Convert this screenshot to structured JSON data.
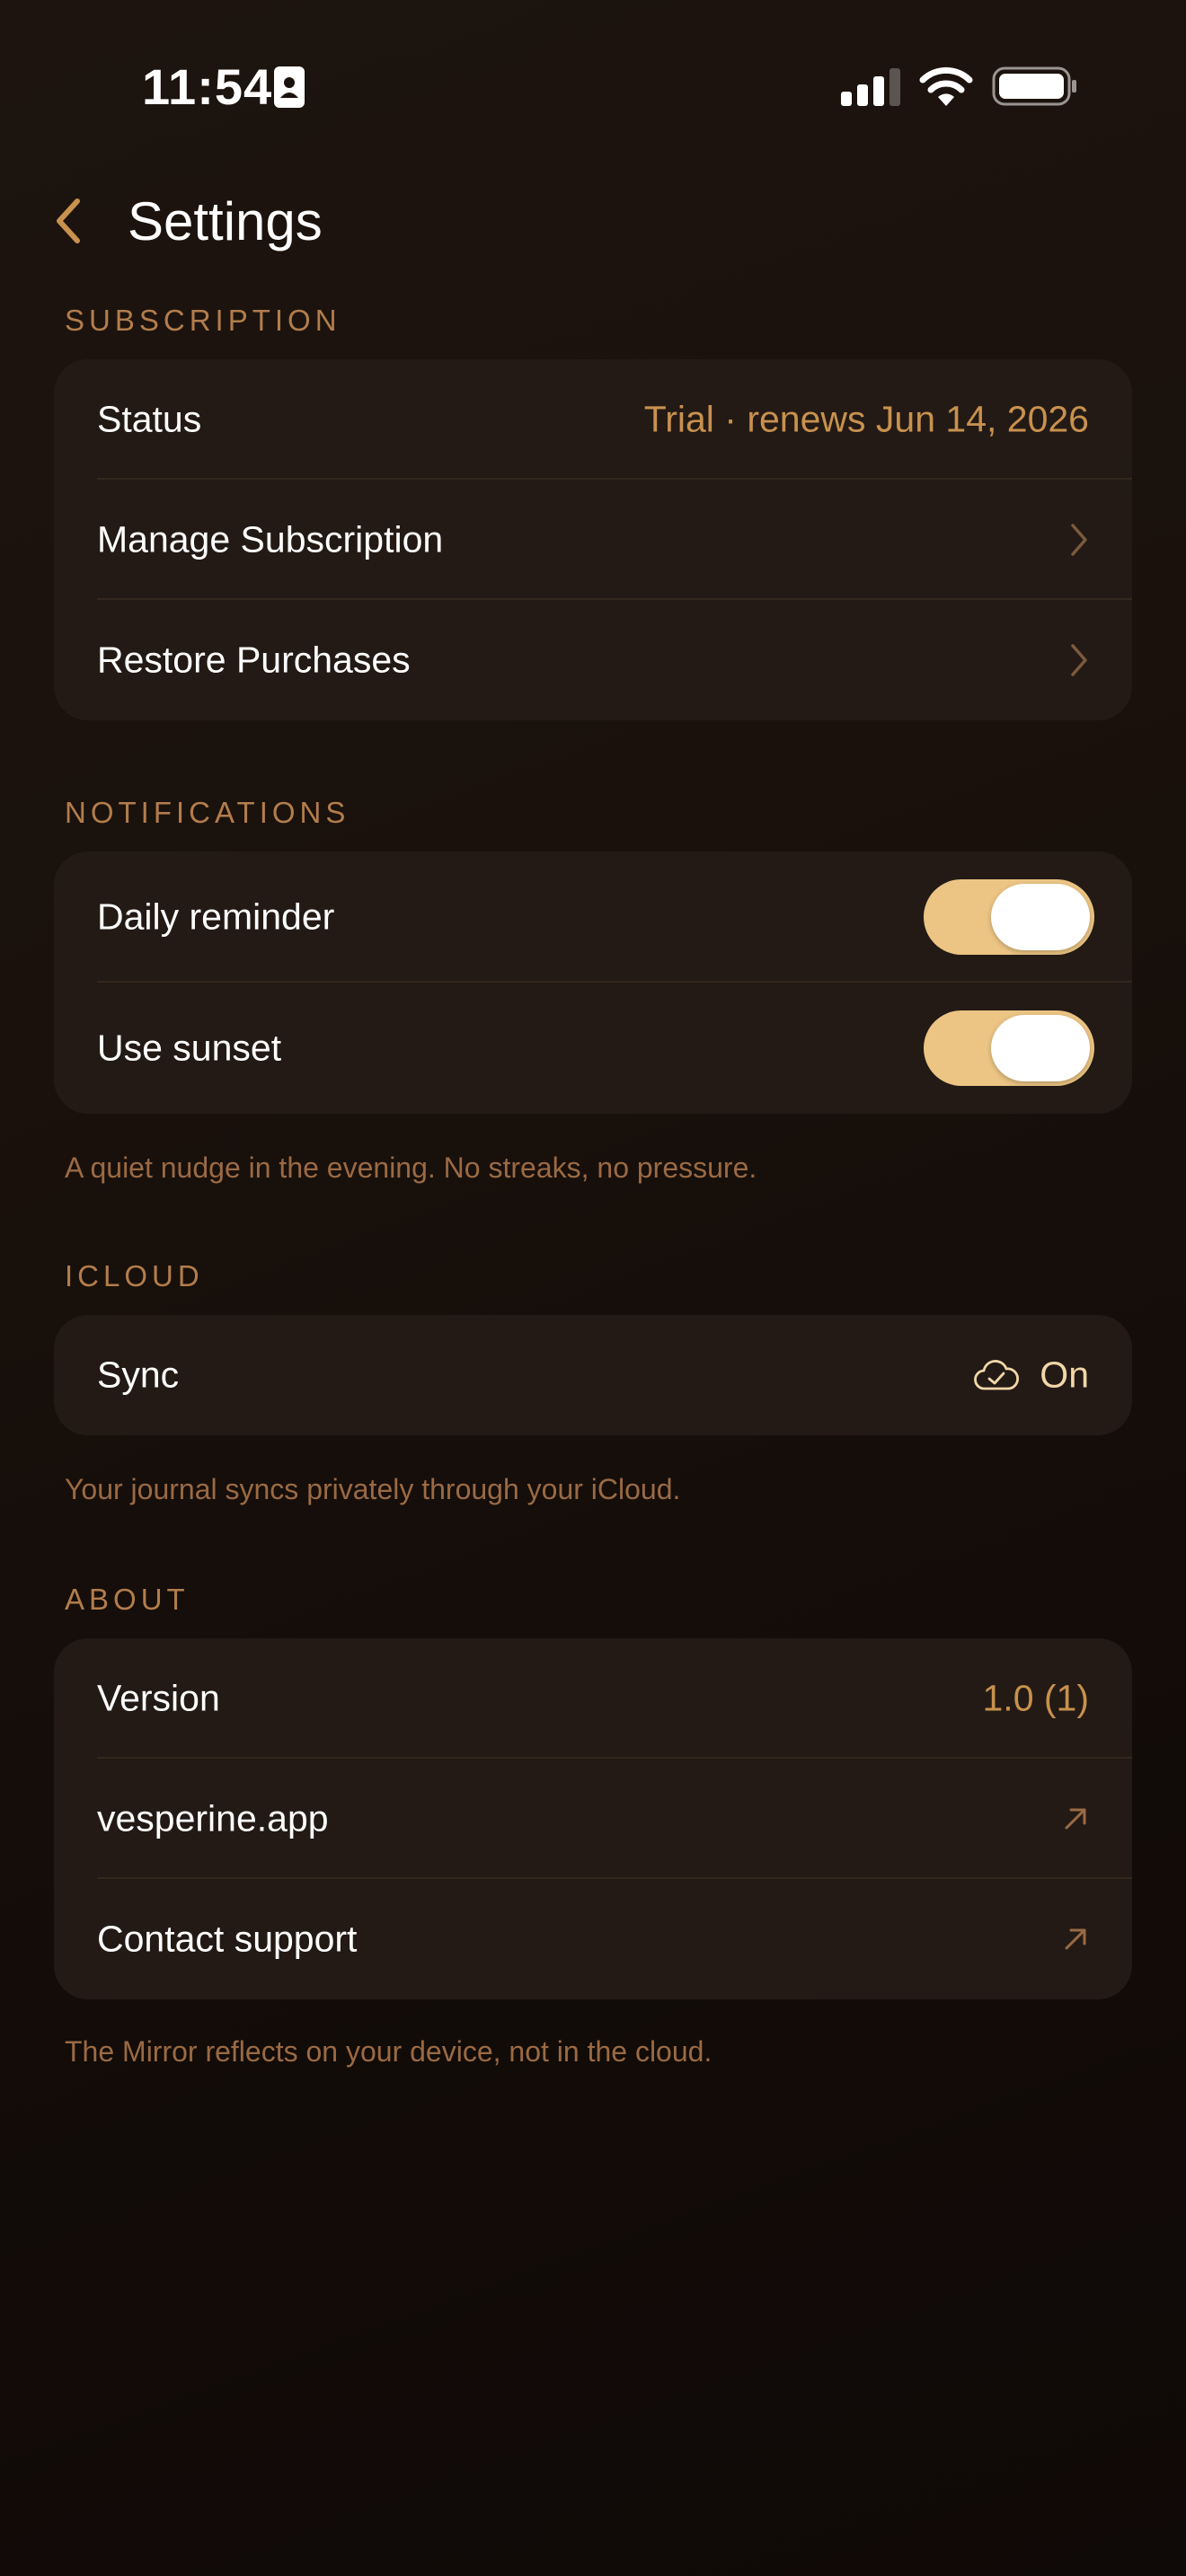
{
  "status_bar": {
    "time": "11:54",
    "icons": [
      "id-card-icon",
      "cellular-signal-icon",
      "wifi-icon",
      "battery-icon"
    ]
  },
  "nav": {
    "title": "Settings",
    "back_icon": "chevron-left-icon"
  },
  "colors": {
    "background": "#1a110c",
    "card": "#231a15",
    "accent": "#c8914e",
    "section_header": "#b27d4c",
    "toggle_on": "#ecc584",
    "footnote": "#9a6a44"
  },
  "sections": {
    "subscription": {
      "header": "SUBSCRIPTION",
      "rows": {
        "status": {
          "label": "Status",
          "value": "Trial · renews Jun 14, 2026"
        },
        "manage": {
          "label": "Manage Subscription"
        },
        "restore": {
          "label": "Restore Purchases"
        }
      }
    },
    "notifications": {
      "header": "NOTIFICATIONS",
      "rows": {
        "daily_reminder": {
          "label": "Daily reminder",
          "on": true
        },
        "use_sunset": {
          "label": "Use sunset",
          "on": true
        }
      },
      "footnote": "A quiet nudge in the evening. No streaks, no pressure."
    },
    "icloud": {
      "header": "ICLOUD",
      "rows": {
        "sync": {
          "label": "Sync",
          "value": "On",
          "icon": "cloud-check-icon"
        }
      },
      "footnote": "Your journal syncs privately through your iCloud."
    },
    "about": {
      "header": "ABOUT",
      "rows": {
        "version": {
          "label": "Version",
          "value": "1.0 (1)"
        },
        "website": {
          "label": "vesperine.app"
        },
        "support": {
          "label": "Contact support"
        }
      },
      "footnote": "The Mirror reflects on your device, not in the cloud."
    }
  }
}
